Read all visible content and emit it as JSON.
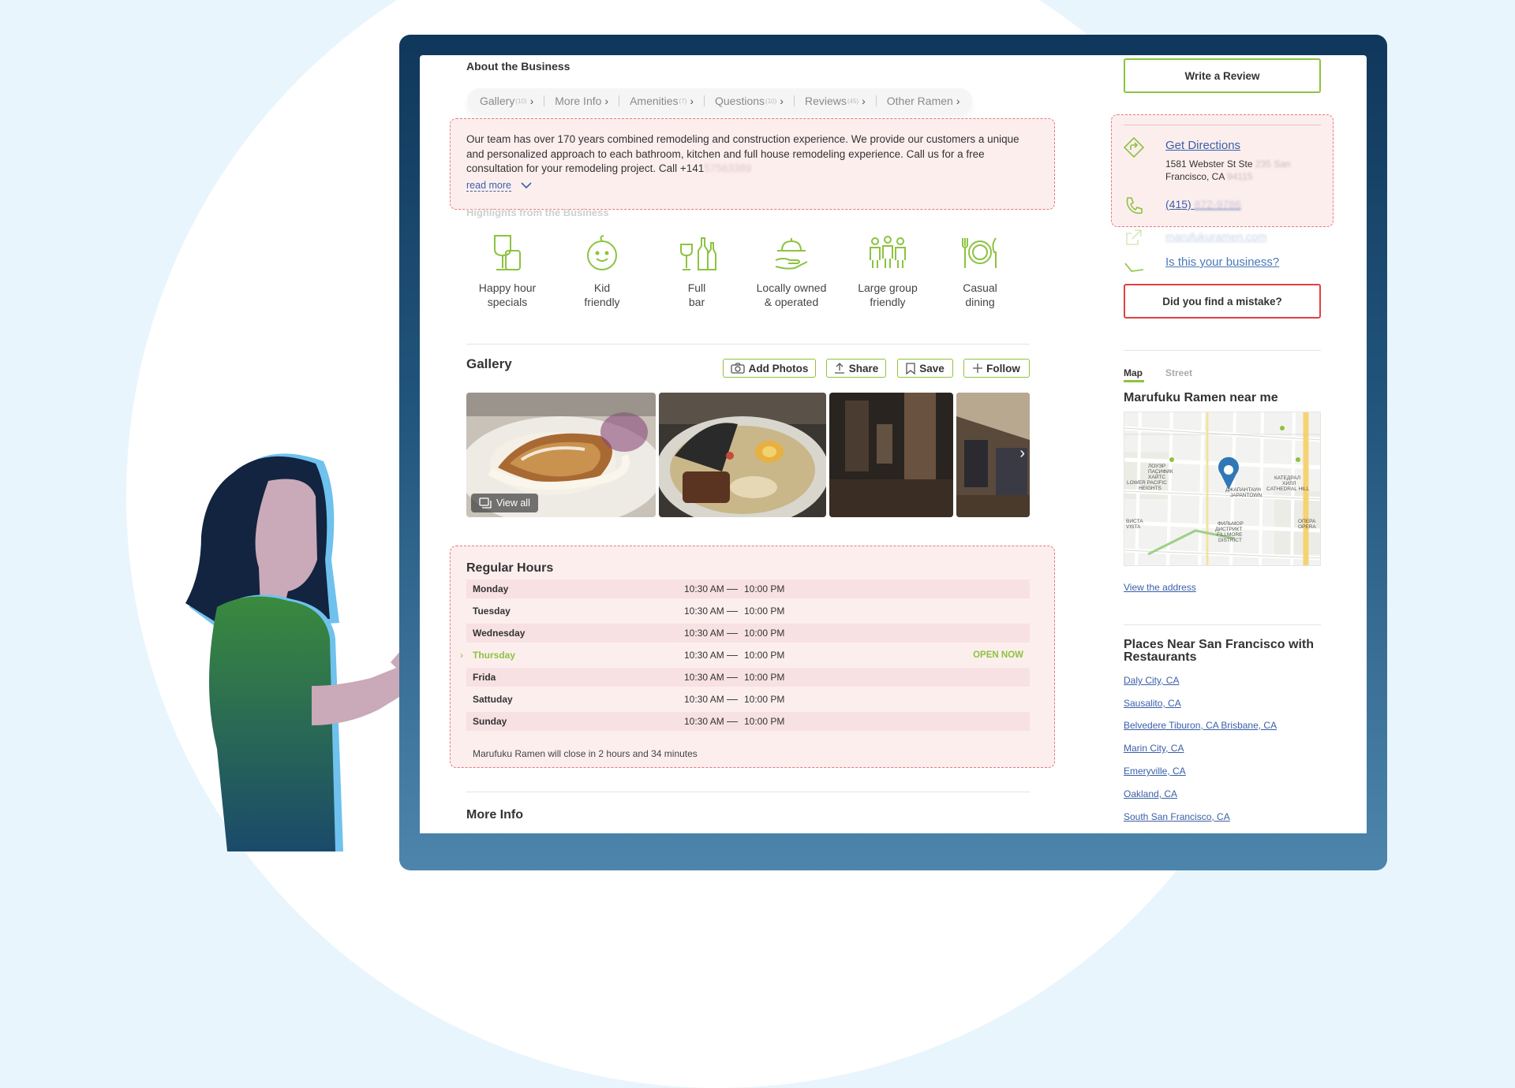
{
  "about": {
    "title": "About the Business",
    "tabs": [
      {
        "label": "Gallery",
        "count": "(10)"
      },
      {
        "label": "More Info",
        "count": ""
      },
      {
        "label": "Amenities",
        "count": "(7)"
      },
      {
        "label": "Questions",
        "count": "(10)"
      },
      {
        "label": "Reviews",
        "count": "(45)"
      },
      {
        "label": "Other Ramen",
        "count": ""
      }
    ],
    "description": "Our team has over 170 years combined remodeling and construction experience. We provide our customers a unique and personalized approach to each bathroom, kitchen and full house remodeling experience. Call us for a free consultation for your remodeling project. Call +141",
    "description_hidden": "57563389",
    "read_more": "read more"
  },
  "highlights": {
    "title": "Highlights from the Business",
    "items": [
      {
        "line1": "Happy hour",
        "line2": "specials",
        "icon": "wine-glass-icon"
      },
      {
        "line1": "Kid",
        "line2": "friendly",
        "icon": "baby-face-icon"
      },
      {
        "line1": "Full",
        "line2": "bar",
        "icon": "bottles-icon"
      },
      {
        "line1": "Locally owned",
        "line2": "& operated",
        "icon": "hand-heart-icon"
      },
      {
        "line1": "Large group",
        "line2": "friendly",
        "icon": "group-people-icon"
      },
      {
        "line1": "Casual",
        "line2": "dining",
        "icon": "plate-cutlery-icon"
      }
    ]
  },
  "gallery": {
    "title": "Gallery",
    "buttons": {
      "add_photos": "Add Photos",
      "share": "Share",
      "save": "Save",
      "follow": "Follow"
    },
    "view_all": "View all"
  },
  "hours": {
    "title": "Regular Hours",
    "rows": [
      {
        "day": "Monday",
        "open": "10:30 AM",
        "close": "10:00 PM",
        "status": ""
      },
      {
        "day": "Tuesday",
        "open": "10:30 AM",
        "close": "10:00 PM",
        "status": ""
      },
      {
        "day": "Wednesday",
        "open": "10:30 AM",
        "close": "10:00 PM",
        "status": ""
      },
      {
        "day": "Thursday",
        "open": "10:30 AM",
        "close": "10:00 PM",
        "status": "OPEN NOW"
      },
      {
        "day": "Frida",
        "open": "10:30 AM",
        "close": "10:00 PM",
        "status": ""
      },
      {
        "day": "Sattuday",
        "open": "10:30 AM",
        "close": "10:00 PM",
        "status": ""
      },
      {
        "day": "Sunday",
        "open": "10:30 AM",
        "close": "10:00 PM",
        "status": ""
      }
    ],
    "note": "Marufuku Ramen will close in 2 hours and 34 minutes"
  },
  "more_info": {
    "title": "More Info"
  },
  "sidebar": {
    "write_review": "Write a Review",
    "get_directions": "Get Directions",
    "address_line1": "1581 Webster St Ste",
    "address_line1_hidden": "235 San",
    "address_line2": "Francisco, CA",
    "address_line2_hidden": "94115",
    "phone": "(415)",
    "phone_hidden": "872-9786",
    "website": "marufukuramen.com",
    "claim": "Is this your business?",
    "mistake": "Did you find a mistake?",
    "map_tab": "Map",
    "street_tab": "Street",
    "map_title": "Marufuku Ramen near me",
    "view_address": "View the address",
    "places_title": "Places Near San Francisco with Restaurants",
    "places": [
      "Daly City, CA",
      "Sausalito, CA",
      "Belvedere Tiburon, CA Brisbane, CA",
      "Marin City, CA",
      "Emeryville, CA",
      "Oakland, CA",
      "South San Francisco, CA"
    ]
  },
  "map_labels": {
    "lower_pacific": "ЛОУЭР ПАСИФИК ХАЙТС LOWER PACIFIC HEIGHTS",
    "japantown": "ДЖАПАНТАУН JAPANTOWN",
    "cathedral": "КАТЕДРАЛ ХИЛЛ CATHEDRAL HILL",
    "fillmore": "ФИЛЬМОР ДИСТРИКТ FILLMORE DISTRICT",
    "vista": "ВИСТА VISTA",
    "opera": "ОПЕРА OPERA"
  },
  "colors": {
    "accent_green": "#8cc33f",
    "link_blue": "#3a5fa8",
    "highlight_red": "#e7787e",
    "mistake_red": "#e24040",
    "map_pin": "#2f78b7"
  }
}
